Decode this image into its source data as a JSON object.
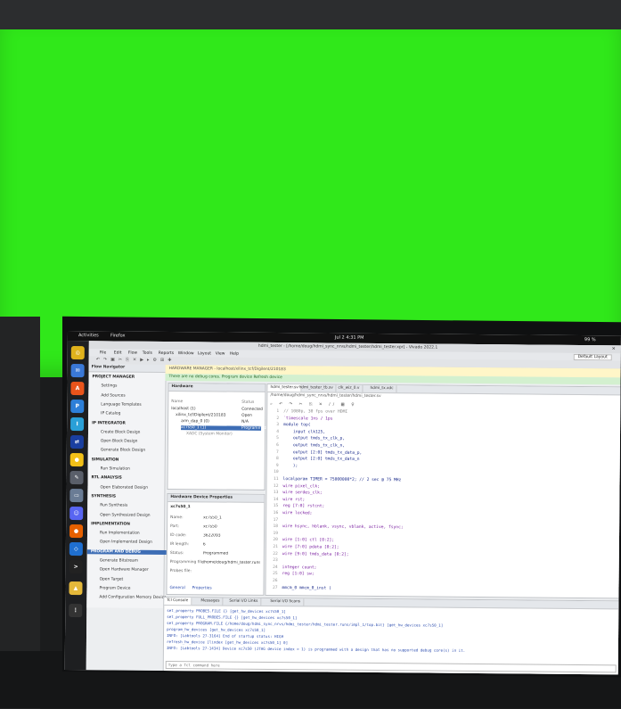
{
  "gnome": {
    "activities": "Activities",
    "app": "Firefox",
    "clock": "Jul 2  4:31 PM",
    "battery": "99 %"
  },
  "window": {
    "title": "hdmi_tester - [/home/doug/hdmi_sync_nrvs/hdmi_tester/hdmi_tester.xpr] - Vivado 2022.1"
  },
  "menu": [
    "File",
    "Edit",
    "Flow",
    "Tools",
    "Reports",
    "Window",
    "Layout",
    "View",
    "Help"
  ],
  "layout_select": "Default Layout",
  "flow": {
    "header": "Flow Navigator",
    "items": [
      {
        "label": "PROJECT MANAGER",
        "section": true
      },
      {
        "label": "Settings"
      },
      {
        "label": "Add Sources"
      },
      {
        "label": "Language Templates"
      },
      {
        "label": "IP Catalog"
      },
      {
        "label": "IP INTEGRATOR",
        "section": true
      },
      {
        "label": "Create Block Design"
      },
      {
        "label": "Open Block Design"
      },
      {
        "label": "Generate Block Design"
      },
      {
        "label": "SIMULATION",
        "section": true
      },
      {
        "label": "Run Simulation"
      },
      {
        "label": "RTL ANALYSIS",
        "section": true
      },
      {
        "label": "Open Elaborated Design"
      },
      {
        "label": "SYNTHESIS",
        "section": true
      },
      {
        "label": "Run Synthesis"
      },
      {
        "label": "Open Synthesized Design"
      },
      {
        "label": "IMPLEMENTATION",
        "section": true
      },
      {
        "label": "Run Implementation"
      },
      {
        "label": "Open Implemented Design"
      },
      {
        "label": "PROGRAM AND DEBUG",
        "section": true,
        "selected": true
      },
      {
        "label": "Generate Bitstream"
      },
      {
        "label": "Open Hardware Manager"
      },
      {
        "label": "Open Target"
      },
      {
        "label": "Program Device"
      },
      {
        "label": "Add Configuration Memory Device"
      }
    ]
  },
  "banner": "HARDWARE MANAGER - localhost/xilinx_tcf/Digilent/210183",
  "banner2": "There are no debug cores.  Program device  Refresh device",
  "hardware": {
    "header": "Hardware",
    "cols": [
      "Name",
      "Status"
    ],
    "rows": [
      {
        "name": "localhost (1)",
        "status": "Connected"
      },
      {
        "name": "xilinx_tcf/Digilent/210183",
        "status": "Open"
      },
      {
        "name": "arm_dap_0 (0)",
        "status": "N/A"
      },
      {
        "name": "xc7s50_1 (1)",
        "status": "Programmed"
      },
      {
        "name": "XADC (System Monitor)",
        "status": ""
      }
    ]
  },
  "props": {
    "header": "Hardware Device Properties",
    "device": "xc7s50_1",
    "rows": [
      {
        "k": "Name:",
        "v": "xc7s50_1"
      },
      {
        "k": "Part:",
        "v": "xc7s50"
      },
      {
        "k": "ID code:",
        "v": "3622093"
      },
      {
        "k": "IR length:",
        "v": "6"
      },
      {
        "k": "Status:",
        "v": "Programmed"
      },
      {
        "k": "Programming file:",
        "v": "/home/doug/hdmi_tester.runs/impl_1/..."
      },
      {
        "k": "Probes file:",
        "v": ""
      }
    ],
    "tabs": [
      "General",
      "Properties"
    ]
  },
  "editor": {
    "tabs": [
      "hdmi_tester.sv",
      "hdmi_tester_tb.sv",
      "clk_wiz_0.v",
      "hdmi_tx.xdc"
    ],
    "path": "/home/doug/hdmi_sync_nrvs/hdmi_tester/hdmi_tester.sv",
    "lines": [
      {
        "n": "1",
        "t": "// 1080p, 30 fps over HDMI",
        "c": "cm"
      },
      {
        "n": "2",
        "t": "`timescale 1ns / 1ps",
        "c": "kw"
      },
      {
        "n": "3",
        "t": "module top(",
        "c": ""
      },
      {
        "n": "4",
        "t": "    input clk125,",
        "c": ""
      },
      {
        "n": "5",
        "t": "    output tmds_tx_clk_p,",
        "c": ""
      },
      {
        "n": "6",
        "t": "    output tmds_tx_clk_n,",
        "c": ""
      },
      {
        "n": "7",
        "t": "    output [2:0] tmds_tx_data_p,",
        "c": ""
      },
      {
        "n": "8",
        "t": "    output [2:0] tmds_tx_data_n",
        "c": ""
      },
      {
        "n": "9",
        "t": "    );",
        "c": ""
      },
      {
        "n": "10",
        "t": "",
        "c": ""
      },
      {
        "n": "11",
        "t": "localparam TIMER = 75000000*2; // 2 sec @ 75 MHz",
        "c": ""
      },
      {
        "n": "12",
        "t": "wire pixel_clk;",
        "c": "kw"
      },
      {
        "n": "13",
        "t": "wire serdes_clk;",
        "c": "kw"
      },
      {
        "n": "14",
        "t": "wire rst;",
        "c": "kw"
      },
      {
        "n": "15",
        "t": "reg [7:0] rstcnt;",
        "c": "kw"
      },
      {
        "n": "16",
        "t": "wire locked;",
        "c": "kw"
      },
      {
        "n": "17",
        "t": "",
        "c": ""
      },
      {
        "n": "18",
        "t": "wire hsync, hblank, vsync, vblank, active, fsync;",
        "c": "kw"
      },
      {
        "n": "19",
        "t": "",
        "c": ""
      },
      {
        "n": "20",
        "t": "wire [1:0] ctl [0:2];",
        "c": "kw"
      },
      {
        "n": "21",
        "t": "wire [7:0] pdata [0:2];",
        "c": "kw"
      },
      {
        "n": "22",
        "t": "wire [9:0] tmds_data [0:2];",
        "c": "kw"
      },
      {
        "n": "23",
        "t": "",
        "c": ""
      },
      {
        "n": "24",
        "t": "integer count;",
        "c": "kw"
      },
      {
        "n": "25",
        "t": "reg [1:0] sw;",
        "c": "kw"
      },
      {
        "n": "26",
        "t": "",
        "c": ""
      },
      {
        "n": "27",
        "t": "mmcm_0 mmcm_0_inst (",
        "c": ""
      }
    ]
  },
  "console": {
    "tabs": [
      "Tcl Console",
      "Messages",
      "Serial I/O Links",
      "Serial I/O Scans"
    ],
    "lines": [
      "set_property PROBES.FILE {} [get_hw_devices xc7s50_1]",
      "set_property FULL_PROBES.FILE {} [get_hw_devices xc7s50_1]",
      "set_property PROGRAM.FILE {/home/doug/hdmi_sync_nrvs/hdmi_tester/hdmi_tester.runs/impl_1/top.bit} [get_hw_devices xc7s50_1]",
      "program_hw_devices [get_hw_devices xc7s50_1]",
      "INFO: [Labtools 27-3164] End of startup status: HIGH",
      "refresh_hw_device [lindex [get_hw_devices xc7s50_1] 0]",
      "INFO: [Labtools 27-1434] Device xc7s50 (JTAG device index = 1) is programmed with a design that has no supported debug core(s) in it."
    ],
    "placeholder": "Type a Tcl command here"
  }
}
